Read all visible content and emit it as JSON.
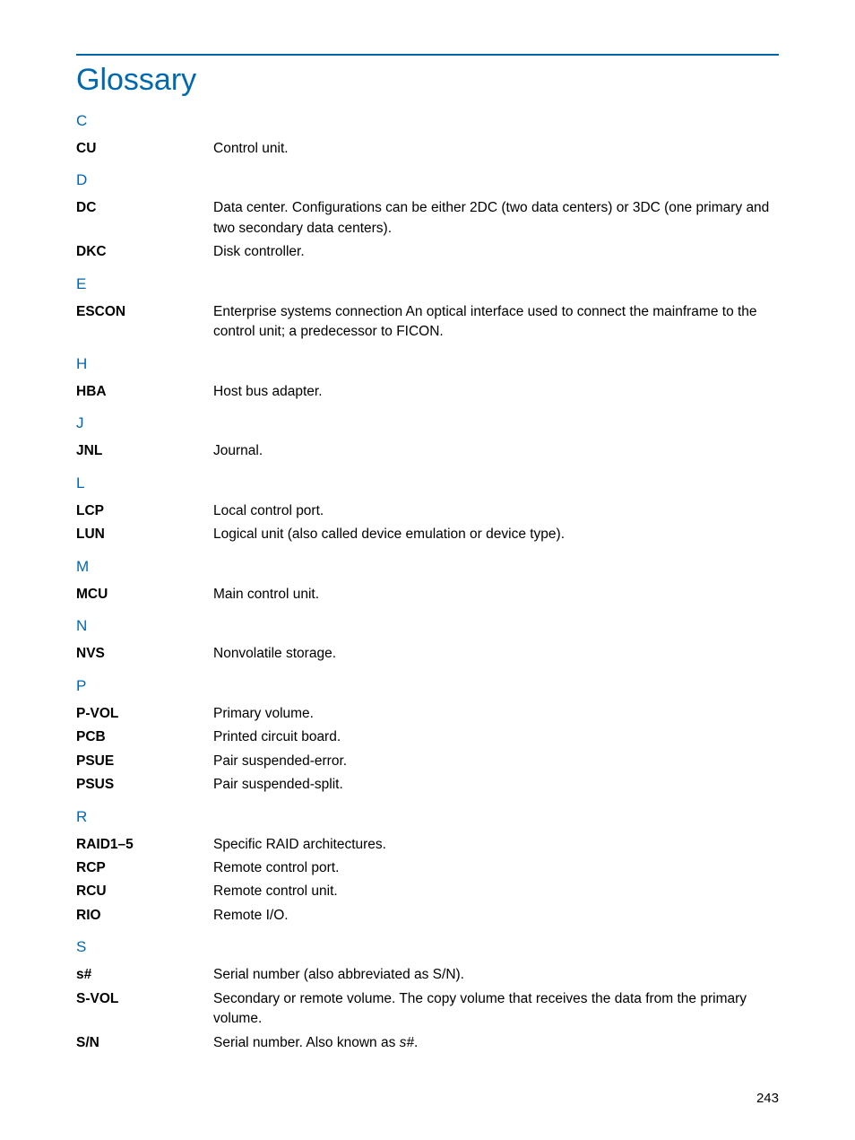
{
  "title": "Glossary",
  "pageNumber": "243",
  "sections": [
    {
      "letter": "C",
      "entries": [
        {
          "term": "CU",
          "definition": "Control unit."
        }
      ]
    },
    {
      "letter": "D",
      "entries": [
        {
          "term": "DC",
          "definition": "Data center. Configurations can be either 2DC (two data centers) or 3DC (one primary and two secondary data centers)."
        },
        {
          "term": "DKC",
          "definition": "Disk controller."
        }
      ]
    },
    {
      "letter": "E",
      "entries": [
        {
          "term": "ESCON",
          "definition": "Enterprise systems connection An optical interface used to connect the mainframe to the control unit; a predecessor to FICON."
        }
      ]
    },
    {
      "letter": "H",
      "entries": [
        {
          "term": "HBA",
          "definition": "Host bus adapter."
        }
      ]
    },
    {
      "letter": "J",
      "entries": [
        {
          "term": "JNL",
          "definition": "Journal."
        }
      ]
    },
    {
      "letter": "L",
      "entries": [
        {
          "term": "LCP",
          "definition": "Local control port."
        },
        {
          "term": "LUN",
          "definition": "Logical unit (also called device emulation or device type)."
        }
      ]
    },
    {
      "letter": "M",
      "entries": [
        {
          "term": "MCU",
          "definition": "Main control unit."
        }
      ]
    },
    {
      "letter": "N",
      "entries": [
        {
          "term": "NVS",
          "definition": "Nonvolatile storage."
        }
      ]
    },
    {
      "letter": "P",
      "entries": [
        {
          "term": "P-VOL",
          "definition": "Primary volume."
        },
        {
          "term": "PCB",
          "definition": "Printed circuit board."
        },
        {
          "term": "PSUE",
          "definition": "Pair suspended-error."
        },
        {
          "term": "PSUS",
          "definition": "Pair suspended-split."
        }
      ]
    },
    {
      "letter": "R",
      "entries": [
        {
          "term": "RAID1–5",
          "definition": "Specific RAID architectures."
        },
        {
          "term": "RCP",
          "definition": "Remote control port."
        },
        {
          "term": "RCU",
          "definition": "Remote control unit."
        },
        {
          "term": "RIO",
          "definition": "Remote I/O."
        }
      ]
    },
    {
      "letter": "S",
      "entries": [
        {
          "term": "s#",
          "definition": "Serial number (also abbreviated as S/N)."
        },
        {
          "term": "S-VOL",
          "definition": "Secondary or remote volume. The copy volume that receives the data from the primary volume."
        },
        {
          "term": "S/N",
          "definition": "Serial number. Also known as ",
          "definitionItalic": "s#",
          "definitionAfter": "."
        }
      ]
    }
  ]
}
